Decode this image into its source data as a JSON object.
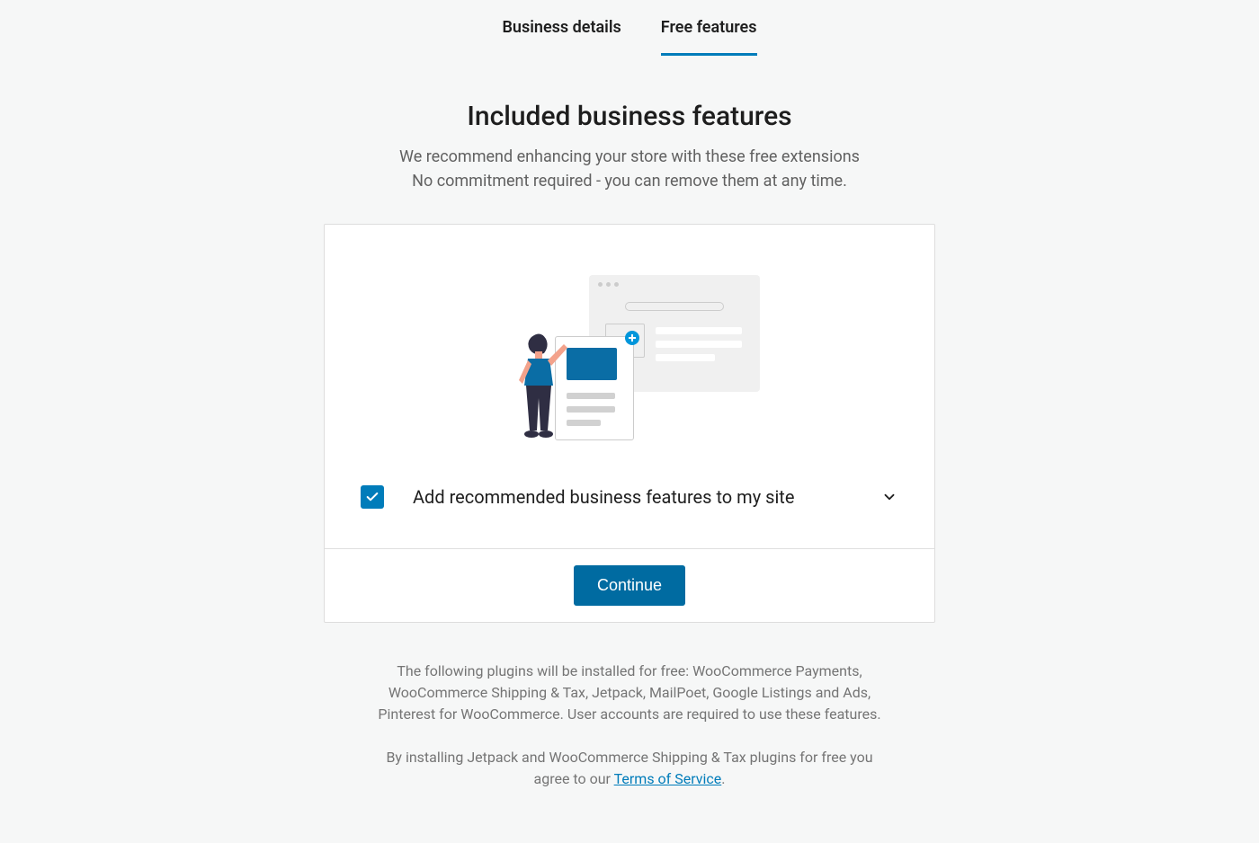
{
  "tabs": {
    "business_details": "Business details",
    "free_features": "Free features"
  },
  "page": {
    "title": "Included business features",
    "subtitle_line1": "We recommend enhancing your store with these free extensions",
    "subtitle_line2": "No commitment required - you can remove them at any time."
  },
  "card": {
    "checkbox_label": "Add recommended business features to my site",
    "checkbox_checked": true,
    "continue_label": "Continue"
  },
  "footer": {
    "plugins_text": "The following plugins will be installed for free: WooCommerce Payments, WooCommerce Shipping & Tax, Jetpack, MailPoet, Google Listings and Ads, Pinterest for WooCommerce. User accounts are required to use these features.",
    "terms_prefix": "By installing Jetpack and WooCommerce Shipping & Tax plugins for free you agree to our ",
    "terms_link": "Terms of Service",
    "terms_suffix": "."
  }
}
